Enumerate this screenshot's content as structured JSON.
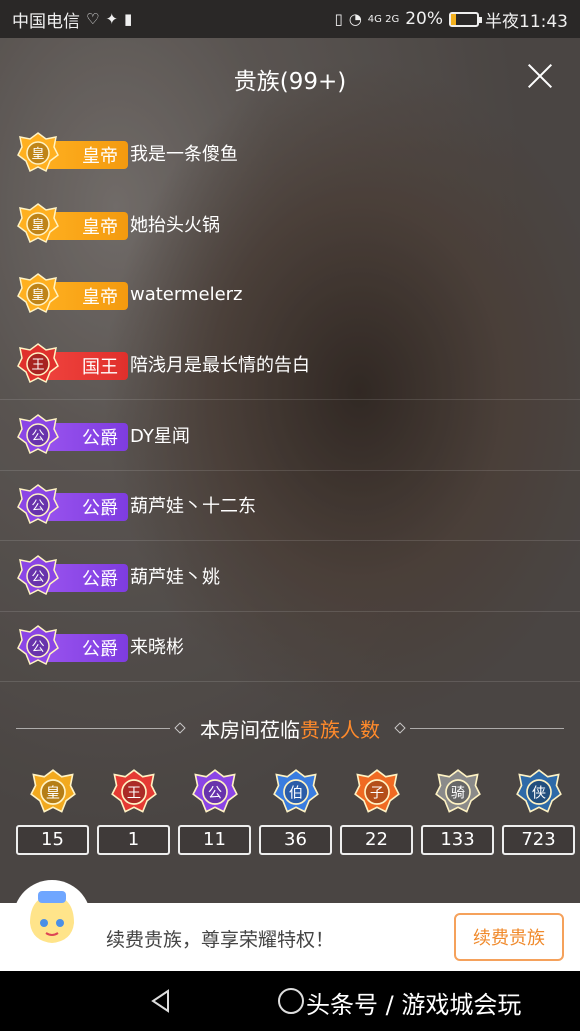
{
  "status_bar": {
    "carrier": "中国电信",
    "battery_percent": "20%",
    "battery_level": 0.2,
    "time": "半夜11:43",
    "network": "4G 2G"
  },
  "panel": {
    "title": "贵族(99+)",
    "close_icon": "close-icon"
  },
  "nobles": [
    {
      "rank": "皇帝",
      "crest_char": "皇",
      "color": "gold",
      "name": "我是一条傻鱼"
    },
    {
      "rank": "皇帝",
      "crest_char": "皇",
      "color": "gold",
      "name": "她抬头火锅"
    },
    {
      "rank": "皇帝",
      "crest_char": "皇",
      "color": "gold",
      "name": "watermelerz"
    },
    {
      "rank": "国王",
      "crest_char": "王",
      "color": "red",
      "name": "陪浅月是最长情的告白"
    },
    {
      "rank": "公爵",
      "crest_char": "公",
      "color": "purple",
      "name": "DY星闻"
    },
    {
      "rank": "公爵",
      "crest_char": "公",
      "color": "purple",
      "name": "葫芦娃丶十二东"
    },
    {
      "rank": "公爵",
      "crest_char": "公",
      "color": "purple",
      "name": "葫芦娃丶姚"
    },
    {
      "rank": "公爵",
      "crest_char": "公",
      "color": "purple",
      "name": "来晓彬"
    }
  ],
  "divider": {
    "text_prefix": "本房间莅临",
    "text_highlight": "贵族人数"
  },
  "rank_counts": [
    {
      "crest_char": "皇",
      "color": "#f2a91e",
      "count": "15"
    },
    {
      "crest_char": "王",
      "color": "#e53a33",
      "count": "1"
    },
    {
      "crest_char": "公",
      "color": "#8b45e6",
      "count": "11"
    },
    {
      "crest_char": "伯",
      "color": "#3a7de0",
      "count": "36"
    },
    {
      "crest_char": "子",
      "color": "#f06a22",
      "count": "22"
    },
    {
      "crest_char": "骑",
      "color": "#8a8a8a",
      "count": "133"
    },
    {
      "crest_char": "侠",
      "color": "#2e6aa8",
      "count": "723"
    }
  ],
  "footer": {
    "promo_text": "续费贵族，尊享荣耀特权！",
    "renew_button": "续费贵族"
  },
  "nav": {
    "watermark": "头条号 / 游戏城会玩"
  },
  "colors": {
    "gold": "#ffb020",
    "red": "#e0302c",
    "purple": "#8b45e6",
    "highlight": "#ff8a2b"
  }
}
